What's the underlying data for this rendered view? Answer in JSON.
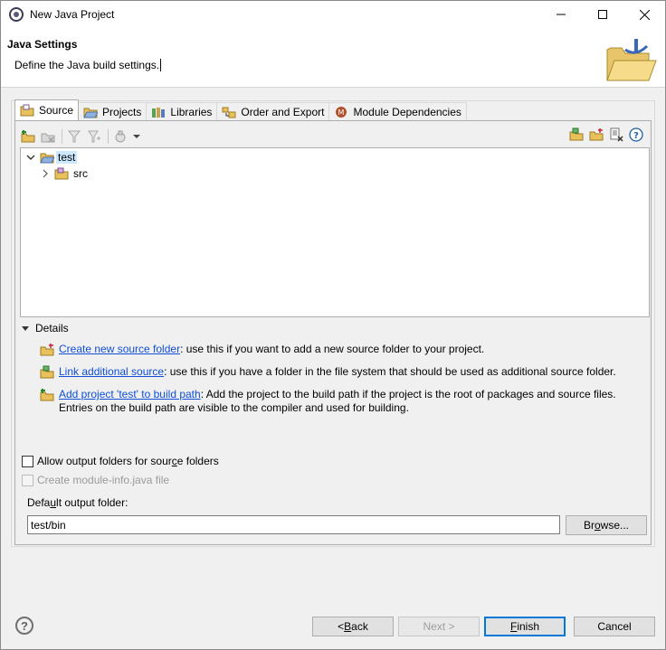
{
  "window": {
    "title": "New Java Project",
    "minimize_glyph": "—",
    "maximize_glyph": "☐",
    "close_glyph": "✕"
  },
  "banner": {
    "title": "Java Settings",
    "description": "Define the Java build settings."
  },
  "tabs": [
    {
      "label": "Source",
      "icon": "source-folder-icon",
      "active": true
    },
    {
      "label": "Projects",
      "icon": "projects-icon"
    },
    {
      "label": "Libraries",
      "icon": "libraries-icon"
    },
    {
      "label": "Order and Export",
      "icon": "order-export-icon"
    },
    {
      "label": "Module Dependencies",
      "icon": "module-icon"
    }
  ],
  "tree": {
    "root": {
      "label": "test",
      "expanded": true,
      "selected": true
    },
    "children": [
      {
        "label": "src",
        "expanded": false
      }
    ]
  },
  "details": {
    "header": "Details",
    "items": [
      {
        "link": "Create new source folder",
        "text": ": use this if you want to add a new source folder to your project."
      },
      {
        "link": "Link additional source",
        "text": ": use this if you have a folder in the file system that should be used as additional source folder."
      },
      {
        "link": "Add project 'test' to build path",
        "text": ": Add the project to the build path if the project is the root of packages and source files.",
        "text2": "Entries on the build path are visible to the compiler and used for building."
      }
    ]
  },
  "options": {
    "allow_output_folders": {
      "label_pre": "Allow output folders for sour",
      "label_mn": "c",
      "label_post": "e folders",
      "checked": false
    },
    "create_module_info": {
      "label": "Create module-info.java file",
      "checked": false,
      "disabled": true
    }
  },
  "output": {
    "label_pre": "Defa",
    "label_mn": "u",
    "label_post": "lt output folder:",
    "value": "test/bin",
    "browse_pre": "Br",
    "browse_mn": "o",
    "browse_post": "wse..."
  },
  "buttons": {
    "back_pre": "< ",
    "back_mn": "B",
    "back_post": "ack",
    "next": "Next >",
    "finish_mn": "F",
    "finish_post": "inish",
    "cancel": "Cancel",
    "help_glyph": "?"
  },
  "colors": {
    "link": "#0f4fd8",
    "selection": "#cce8ff",
    "default_button_border": "#0078d7"
  }
}
